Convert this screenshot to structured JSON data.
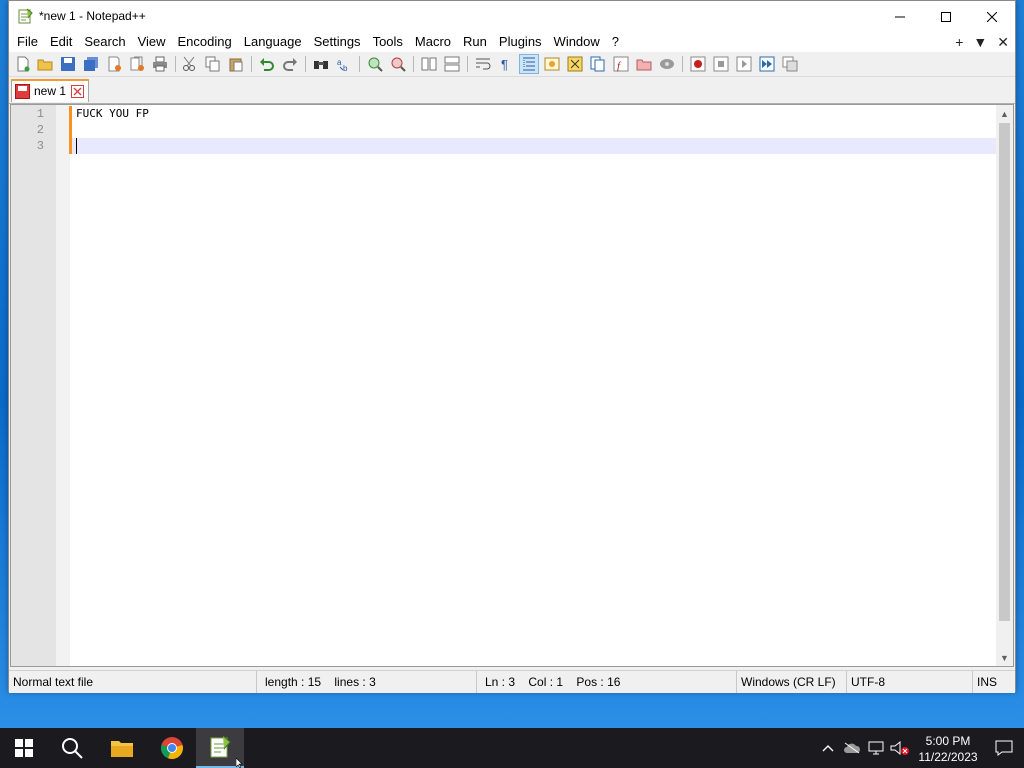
{
  "window": {
    "title": "*new 1 - Notepad++"
  },
  "menu": {
    "items": [
      "File",
      "Edit",
      "Search",
      "View",
      "Encoding",
      "Language",
      "Settings",
      "Tools",
      "Macro",
      "Run",
      "Plugins",
      "Window",
      "?"
    ],
    "right": [
      "+",
      "▼",
      "✕"
    ]
  },
  "tabs": [
    {
      "label": "new 1",
      "modified": true
    }
  ],
  "editor": {
    "lines": [
      "FUCK YOU FP",
      "",
      ""
    ],
    "line_numbers": [
      "1",
      "2",
      "3"
    ],
    "current_line": 3
  },
  "statusbar": {
    "file_type": "Normal text file",
    "length": "length : 15",
    "lines": "lines : 3",
    "ln": "Ln : 3",
    "col": "Col : 1",
    "pos": "Pos : 16",
    "eol": "Windows (CR LF)",
    "encoding": "UTF-8",
    "mode": "INS"
  },
  "taskbar": {
    "time": "5:00 PM",
    "date": "11/22/2023"
  },
  "colors": {
    "accent_orange": "#f39c34",
    "current_line": "#e8e8ff",
    "taskbar": "#1b1b1f"
  }
}
